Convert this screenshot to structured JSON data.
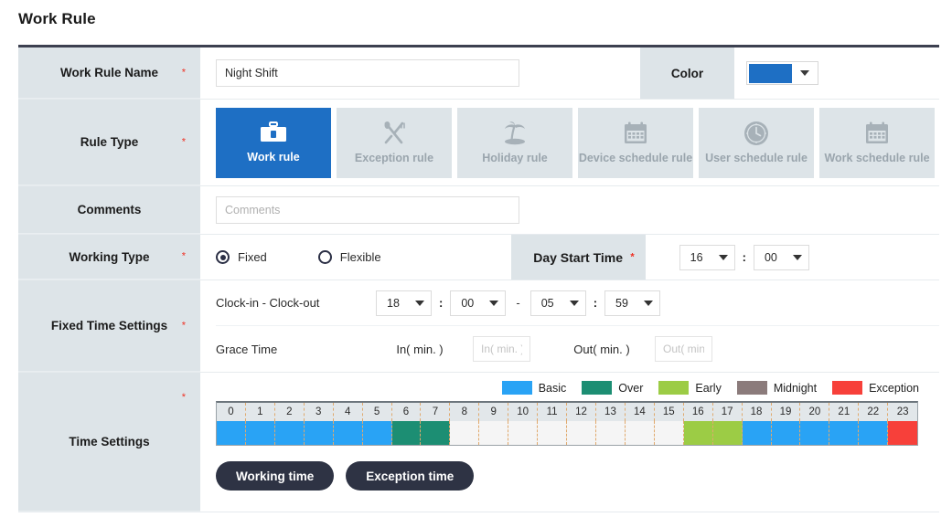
{
  "page": {
    "title": "Work Rule"
  },
  "fields": {
    "work_rule_name": {
      "label": "Work Rule Name",
      "value": "Night Shift",
      "required": "*"
    },
    "color": {
      "label": "Color",
      "swatch_hex": "#1e6fc4"
    },
    "rule_type": {
      "label": "Rule Type",
      "required": "*"
    },
    "comments": {
      "label": "Comments",
      "placeholder": "Comments",
      "value": ""
    },
    "working_type": {
      "label": "Working Type",
      "required": "*"
    },
    "fixed_time_settings": {
      "label": "Fixed Time Settings",
      "required": "*"
    },
    "time_settings": {
      "label": "Time Settings",
      "required": "*"
    }
  },
  "rule_tiles": [
    {
      "label": "Work rule",
      "icon": "toolbox-icon",
      "active": true
    },
    {
      "label": "Exception rule",
      "icon": "cutlery-icon",
      "active": false
    },
    {
      "label": "Holiday rule",
      "icon": "palm-tree-icon",
      "active": false
    },
    {
      "label": "Device schedule rule",
      "icon": "calendar-icon",
      "active": false
    },
    {
      "label": "User schedule rule",
      "icon": "clock-icon",
      "active": false
    },
    {
      "label": "Work schedule rule",
      "icon": "calendar-icon",
      "active": false
    }
  ],
  "working_type": {
    "options": [
      {
        "label": "Fixed",
        "selected": true
      },
      {
        "label": "Flexible",
        "selected": false
      }
    ],
    "day_start_time": {
      "label": "Day Start Time",
      "required": "*",
      "hour": "16",
      "minute": "00",
      "separator": ":"
    }
  },
  "fixed_time": {
    "clock_row_label": "Clock-in - Clock-out",
    "clock_in_hour": "18",
    "clock_in_minute": "00",
    "clock_out_hour": "05",
    "clock_out_minute": "59",
    "separator": ":",
    "range_dash": "-",
    "grace_row_label": "Grace Time",
    "grace_in_label": "In( min. )",
    "grace_in_placeholder": "In( min. )",
    "grace_in_value": "",
    "grace_out_label": "Out( min. )",
    "grace_out_placeholder": "Out( min. )",
    "grace_out_value": ""
  },
  "legend": [
    {
      "label": "Basic",
      "color": "#29a3f5"
    },
    {
      "label": "Over",
      "color": "#1c8e73"
    },
    {
      "label": "Early",
      "color": "#9ccc45"
    },
    {
      "label": "Midnight",
      "color": "#8b7b7b"
    },
    {
      "label": "Exception",
      "color": "#f7403a"
    }
  ],
  "timeline": {
    "hours": [
      "0",
      "1",
      "2",
      "3",
      "4",
      "5",
      "6",
      "7",
      "8",
      "9",
      "10",
      "11",
      "12",
      "13",
      "14",
      "15",
      "16",
      "17",
      "18",
      "19",
      "20",
      "21",
      "22",
      "23"
    ],
    "empty_color": "#f5f5f5",
    "cells": [
      "#29a3f5",
      "#29a3f5",
      "#29a3f5",
      "#29a3f5",
      "#29a3f5",
      "#29a3f5",
      "#1c8e73",
      "#1c8e73",
      "#f5f5f5",
      "#f5f5f5",
      "#f5f5f5",
      "#f5f5f5",
      "#f5f5f5",
      "#f5f5f5",
      "#f5f5f5",
      "#f5f5f5",
      "#9ccc45",
      "#9ccc45",
      "#29a3f5",
      "#29a3f5",
      "#29a3f5",
      "#29a3f5",
      "#29a3f5",
      "#f7403a"
    ],
    "cell_types": [
      "Basic",
      "Basic",
      "Basic",
      "Basic",
      "Basic",
      "Basic",
      "Over",
      "Over",
      "",
      "",
      "",
      "",
      "",
      "",
      "",
      "",
      "Early",
      "Early",
      "Basic",
      "Basic",
      "Basic",
      "Basic",
      "Basic",
      "Exception"
    ]
  },
  "buttons": [
    {
      "label": "Working time"
    },
    {
      "label": "Exception time"
    }
  ]
}
